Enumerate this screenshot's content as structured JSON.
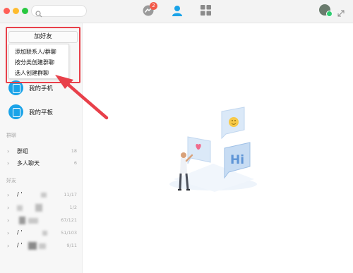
{
  "titlebar": {
    "search_placeholder": "",
    "message_badge": "2"
  },
  "sidebar": {
    "add_friend_button": "加好友",
    "dropdown_items": [
      "添加联系人/群聊",
      "按分类创建群聊",
      "选人创建群聊"
    ],
    "devices": [
      {
        "label": "我的手机"
      },
      {
        "label": "我的平板"
      }
    ],
    "groups_section": {
      "title": "群聊",
      "rows": [
        {
          "name": "群组",
          "count": "18"
        },
        {
          "name": "多人聊天",
          "count": "6"
        }
      ]
    },
    "friends_section": {
      "title": "好友",
      "rows": [
        {
          "name": "/ '",
          "count": "11/17"
        },
        {
          "name": "",
          "count": "1/2"
        },
        {
          "name": "",
          "count": "67/121"
        },
        {
          "name": "/ '",
          "count": "51/103"
        },
        {
          "name": "/ '",
          "count": "9/11"
        }
      ]
    }
  },
  "illustration": {
    "bubble_text": "Hi"
  },
  "colors": {
    "accent_blue": "#1aa3e8",
    "highlight_red": "#e8404a",
    "badge_red": "#f25a4a"
  }
}
